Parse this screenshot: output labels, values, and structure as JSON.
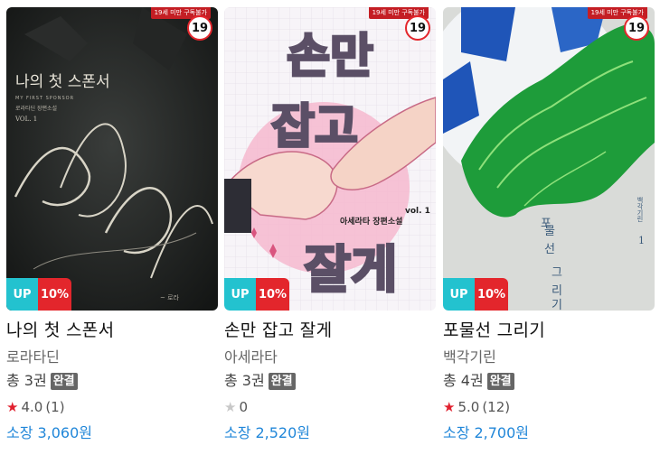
{
  "books": [
    {
      "cover_text": "나의 첫 스폰서",
      "cover_script": "My First Sponsor",
      "age_ribbon": "19세 미만 구독불가",
      "age_label": "19",
      "up_label": "UP",
      "discount": "10%",
      "title": "나의 첫 스폰서",
      "author": "로라타딘",
      "volumes": "총 3권",
      "complete": "완결",
      "rating": "4.0",
      "rating_count": "(1)",
      "price_label": "소장",
      "price": "3,060원"
    },
    {
      "cover_text": "손만 잡고 잘게",
      "cover_subtitle": "아세라타 장편소설",
      "cover_vol": "vol. 1",
      "age_ribbon": "19세 미만 구독불가",
      "age_label": "19",
      "up_label": "UP",
      "discount": "10%",
      "title": "손만 잡고 잘게",
      "author": "아세라타",
      "volumes": "총 3권",
      "complete": "완결",
      "rating": "0",
      "rating_count": "",
      "price_label": "소장",
      "price": "2,520원"
    },
    {
      "cover_text": "포물선 그리기",
      "cover_author": "백각기린",
      "cover_vol": "1",
      "age_ribbon": "19세 미만 구독불가",
      "age_label": "19",
      "up_label": "UP",
      "discount": "10%",
      "title": "포물선 그리기",
      "author": "백각기린",
      "volumes": "총 4권",
      "complete": "완결",
      "rating": "5.0",
      "rating_count": "(12)",
      "price_label": "소장",
      "price": "2,700원"
    }
  ],
  "colors": {
    "up_badge": "#23c2cf",
    "discount_badge": "#e3262c",
    "star_filled": "#e1202e",
    "star_empty": "#c8c8c8",
    "price": "#2187d9"
  }
}
